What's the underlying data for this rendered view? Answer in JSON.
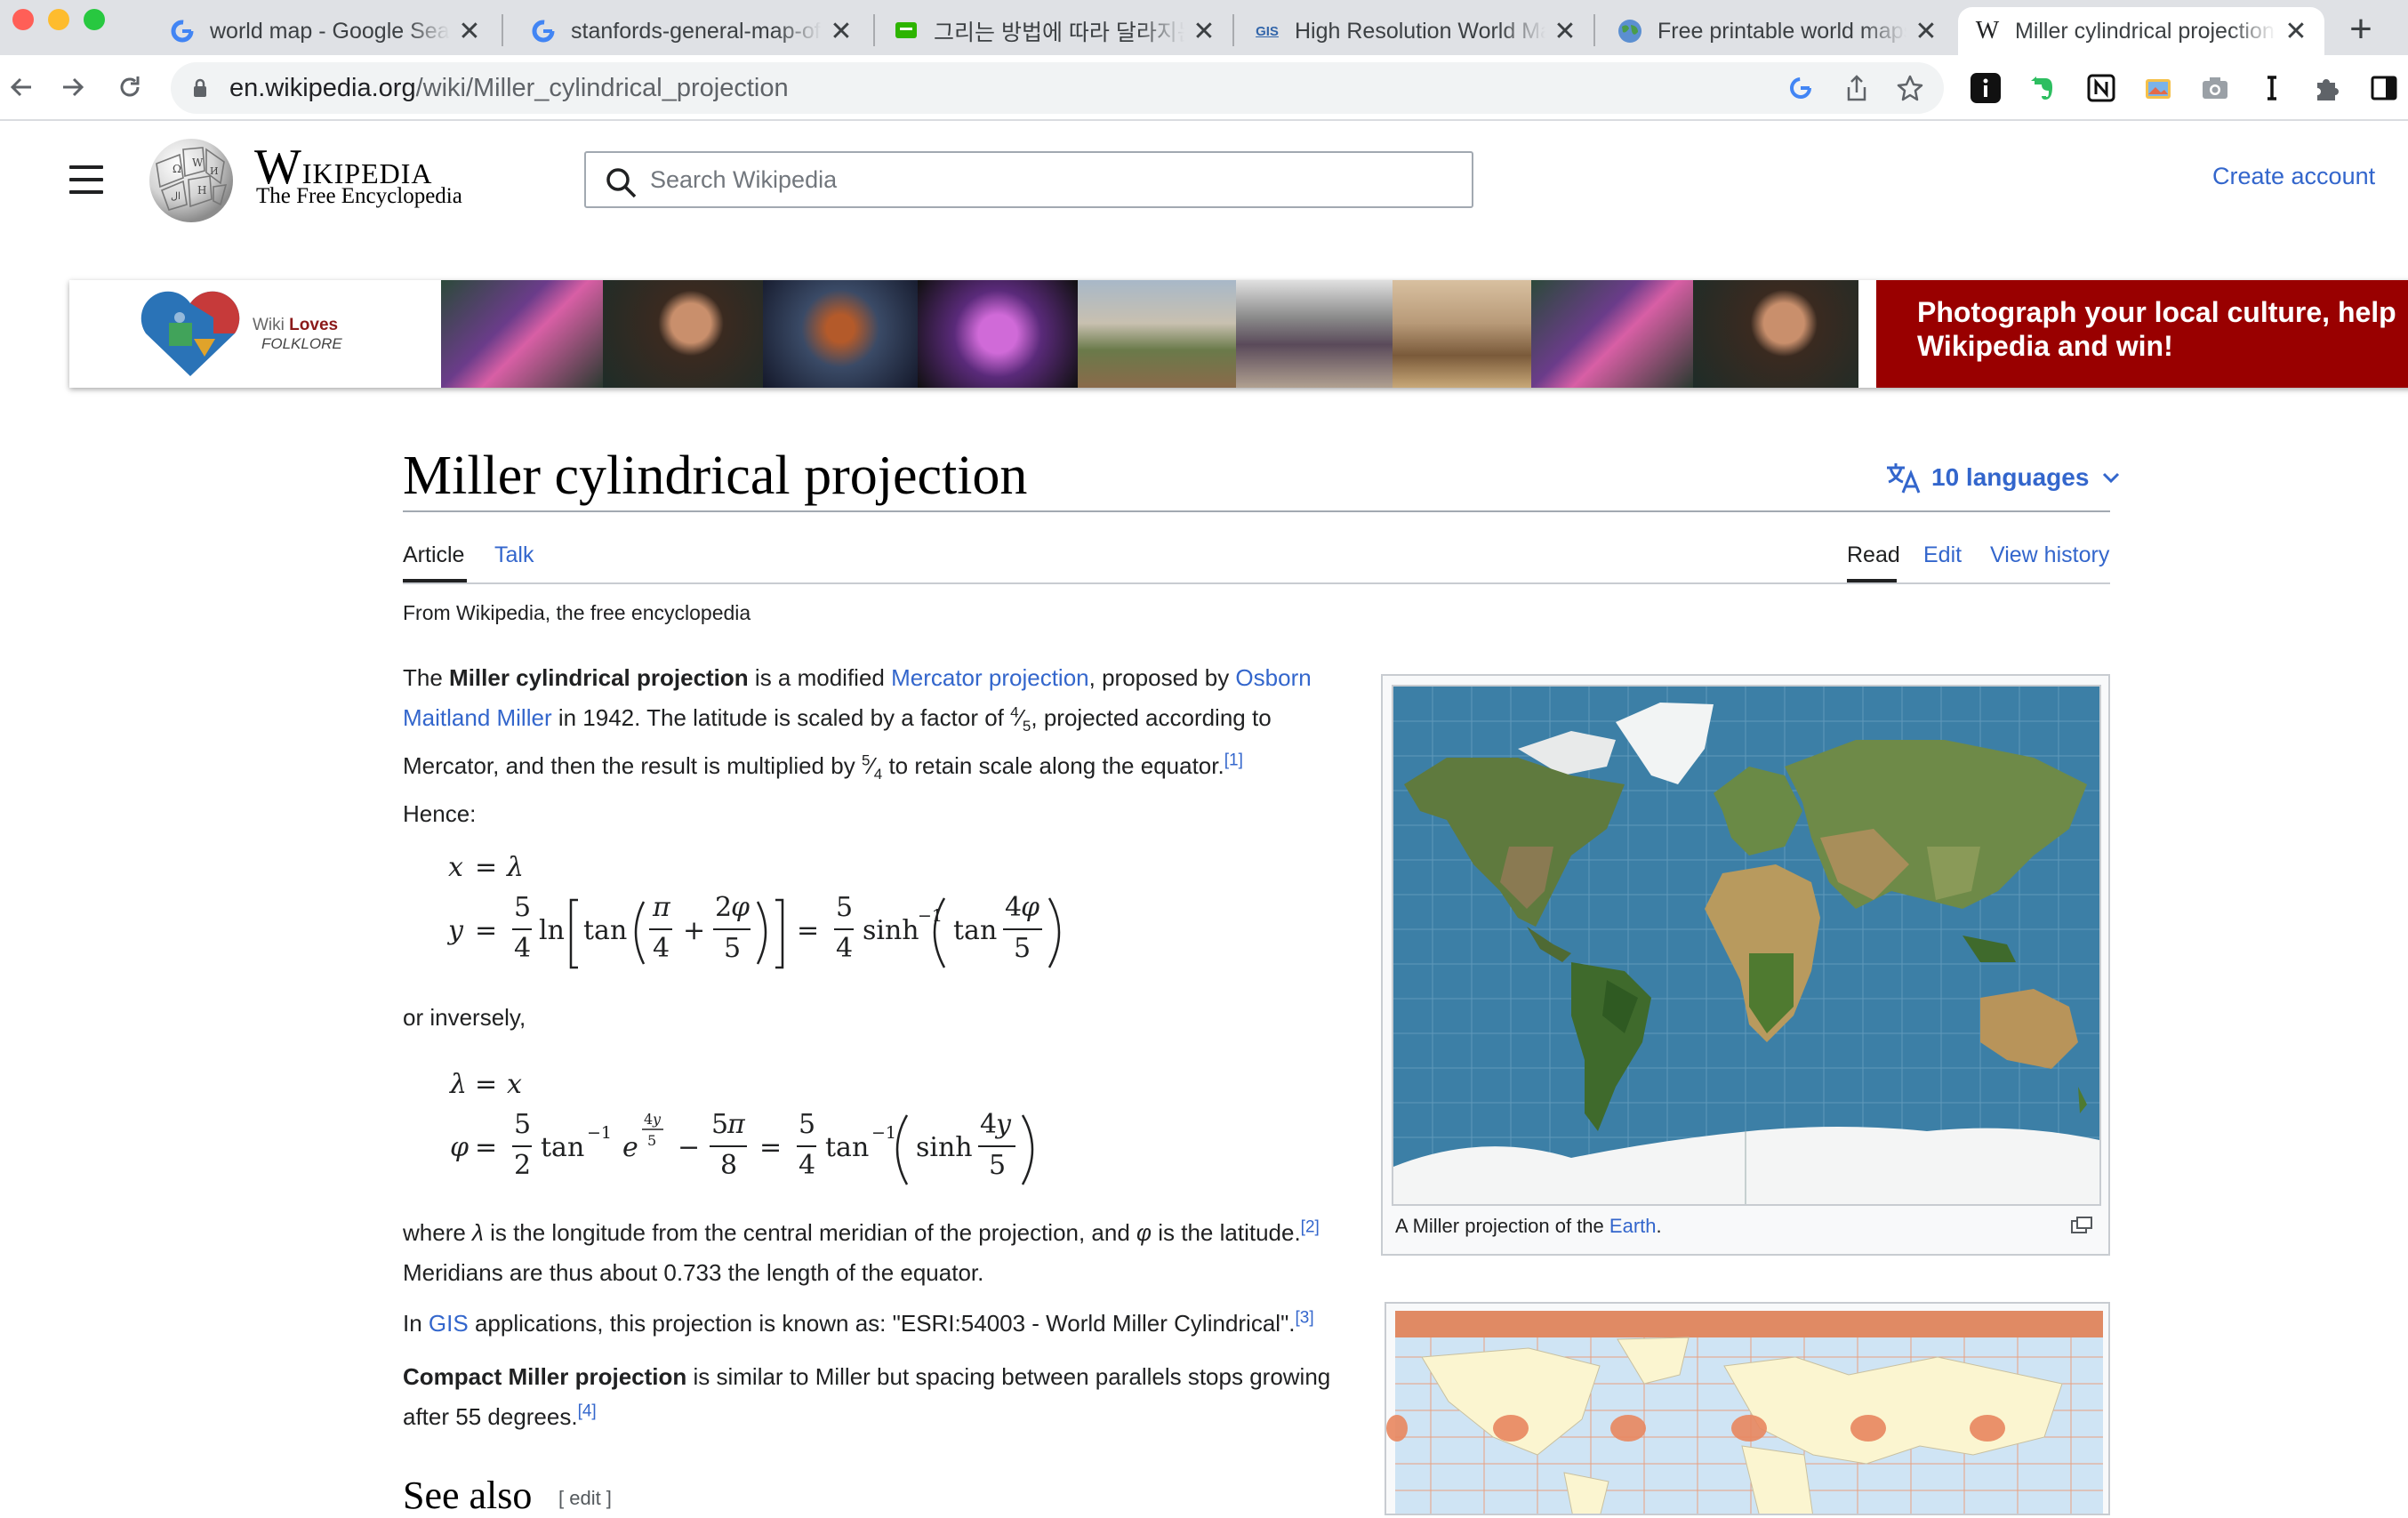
{
  "browser": {
    "tabs": [
      {
        "title": "world map - Google Search",
        "icon": "google-icon"
      },
      {
        "title": "stanfords-general-map-of-the-world",
        "icon": "google-icon"
      },
      {
        "title": "그리는 방법에 따라 달라지는 세계지도",
        "icon": "naver-blog-icon"
      },
      {
        "title": "High Resolution World Map",
        "icon": "gis-icon"
      },
      {
        "title": "Free printable world maps",
        "icon": "globe-icon"
      },
      {
        "title": "Miller cylindrical projection",
        "icon": "wikipedia-icon",
        "active": true
      }
    ],
    "new_tab": "+",
    "url_host": "en.wikipedia.org",
    "url_path": "/wiki/Miller_cylindrical_projection",
    "tab_close": "✕"
  },
  "wiki": {
    "wordmark": "Wikipedia",
    "tagline": "The Free Encyclopedia",
    "search_placeholder": "Search Wikipedia",
    "create_account": "Create account"
  },
  "banner": {
    "wiki": "Wiki",
    "loves": "Loves",
    "folklore": "FOLKLORE",
    "cta": "Photograph your local culture, help Wikipedia and win!"
  },
  "article": {
    "title": "Miller cylindrical projection",
    "languages": "10 languages",
    "tabs_left": [
      "Article",
      "Talk"
    ],
    "tabs_right": [
      "Read",
      "Edit",
      "View history"
    ],
    "from": "From Wikipedia, the free encyclopedia",
    "intro": {
      "t1": "The ",
      "bold": "Miller cylindrical projection",
      "t2": " is a modified ",
      "link1": "Mercator projection",
      "t3": ", proposed by ",
      "link2": "Osborn Maitland Miller",
      "t4": " in 1942. The latitude is scaled by a factor of ",
      "frac1_num": "4",
      "frac1_den": "5",
      "t5": ", projected according to Mercator, and then the result is multiplied by ",
      "frac2_num": "5",
      "frac2_den": "4",
      "t6": " to retain scale along the equator.",
      "ref": "[1]",
      "t7": " Hence:"
    },
    "inversely": "or inversely,",
    "where": {
      "t1": "where ",
      "lambda": "λ",
      "t2": " is the longitude from the central meridian of the projection, and ",
      "phi": "φ",
      "t3": " is the latitude.",
      "ref": "[2]",
      "t4": " Meridians are thus about 0.733 the length of the equator."
    },
    "gis": {
      "t1": "In ",
      "link": "GIS",
      "t2": " applications, this projection is known as: \"ESRI:54003 - World Miller Cylindrical\".",
      "ref": "[3]"
    },
    "compact": {
      "bold": "Compact Miller projection",
      "t1": " is similar to Miller but spacing between parallels stops growing after 55 degrees.",
      "ref": "[4]"
    },
    "see_also": "See also",
    "see_also_edit": "[ edit ]",
    "caption_text": "A Miller projection of the ",
    "caption_link": "Earth",
    "caption_end": "."
  },
  "colors": {
    "link": "#3366cc",
    "banner_red": "#990000",
    "ocean": "#3c7fa6"
  }
}
